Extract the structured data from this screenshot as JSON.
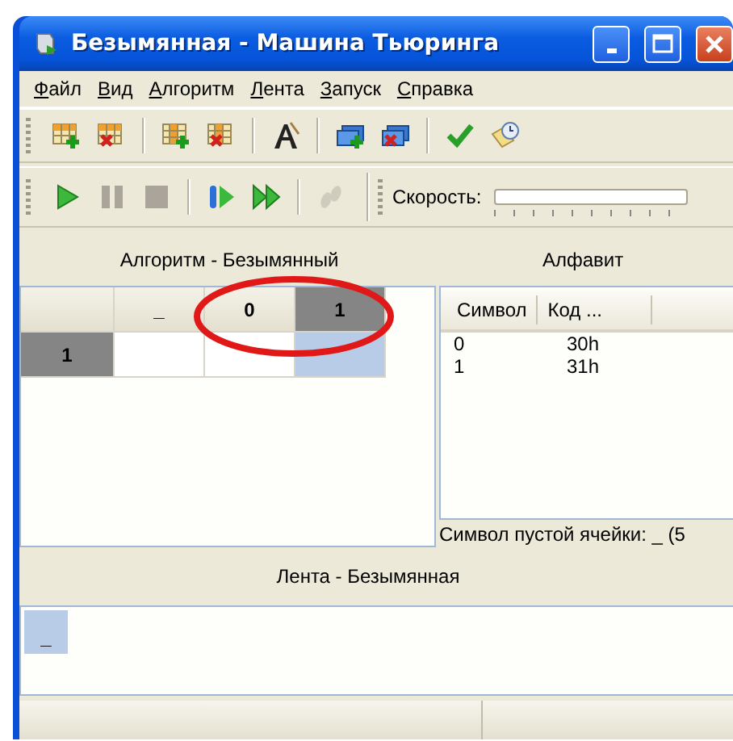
{
  "window": {
    "title": "Безымянная - Машина Тьюринга",
    "controls": [
      {
        "kind": "minimize"
      },
      {
        "kind": "maximize"
      },
      {
        "kind": "close"
      }
    ]
  },
  "menu": [
    {
      "label": "Файл"
    },
    {
      "label": "Вид"
    },
    {
      "label": "Алгоритм"
    },
    {
      "label": "Лента"
    },
    {
      "label": "Запуск"
    },
    {
      "label": "Справка"
    }
  ],
  "toolbar_edit": [
    [
      {
        "kind": "add-row",
        "disabled": false
      },
      {
        "kind": "delete-row",
        "disabled": false
      }
    ],
    [
      {
        "kind": "add-column",
        "disabled": false
      },
      {
        "kind": "delete-column",
        "disabled": false
      }
    ],
    [
      {
        "kind": "font",
        "disabled": false
      }
    ],
    [
      {
        "kind": "add-window",
        "disabled": false
      },
      {
        "kind": "delete-window",
        "disabled": false
      }
    ],
    [
      {
        "kind": "check",
        "disabled": false
      },
      {
        "kind": "notes-clock",
        "disabled": false
      }
    ]
  ],
  "toolbar_run": [
    [
      {
        "kind": "play",
        "disabled": false
      },
      {
        "kind": "pause",
        "disabled": false
      },
      {
        "kind": "stop",
        "disabled": false
      }
    ],
    [
      {
        "kind": "step",
        "disabled": false
      },
      {
        "kind": "fast-forward",
        "disabled": false
      }
    ],
    [
      {
        "kind": "footprints",
        "disabled": true
      }
    ]
  ],
  "speed": {
    "label": "Скорость:",
    "level": 0
  },
  "algorithm": {
    "title": "Алгоритм - Безымянный",
    "columns": [
      {
        "symbol": "_",
        "selected": false
      },
      {
        "symbol": "0",
        "selected": false
      },
      {
        "symbol": "1",
        "selected": true
      }
    ],
    "rows": [
      {
        "state": "1",
        "selected": true,
        "cells": [
          {
            "selected": false
          },
          {
            "selected": false
          },
          {
            "selected": true
          }
        ]
      }
    ],
    "annotations": [
      {
        "kind": "ellipse"
      }
    ]
  },
  "alphabet": {
    "title": "Алфавит",
    "columns": [
      "Символ",
      "Код ..."
    ],
    "rows": [
      [
        "0",
        "30h"
      ],
      [
        "1",
        "31h"
      ]
    ],
    "blank_symbol": "Символ пустой ячейки: _ (5"
  },
  "tape": {
    "title": "Лента - Безымянная",
    "cells": [
      {
        "symbol": "_",
        "selected": true
      }
    ]
  }
}
